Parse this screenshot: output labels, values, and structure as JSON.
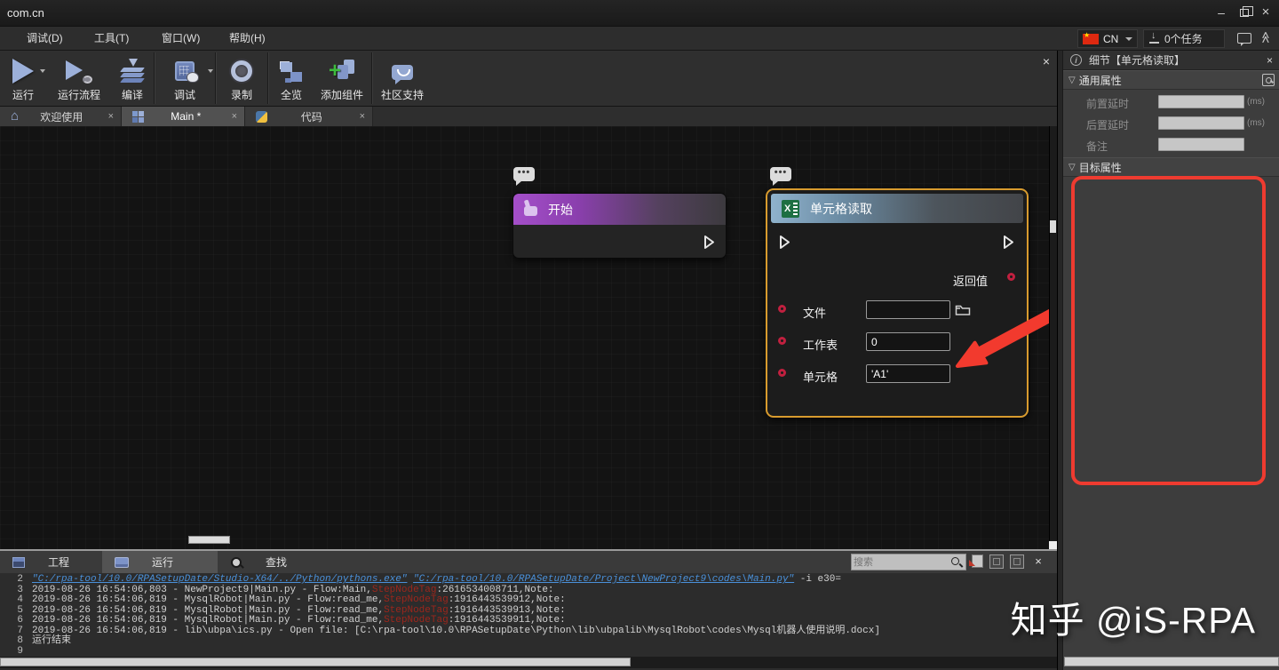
{
  "window": {
    "title": "com.cn"
  },
  "menu": {
    "items": [
      "调试(D)",
      "工具(T)",
      "窗口(W)",
      "帮助(H)"
    ],
    "lang": "CN",
    "tasks": "0个任务"
  },
  "toolbar": {
    "buttons": [
      {
        "label": "运行"
      },
      {
        "label": "运行流程"
      },
      {
        "label": "编译"
      },
      {
        "label": "调试"
      },
      {
        "label": "录制"
      },
      {
        "label": "全览"
      },
      {
        "label": "添加组件"
      },
      {
        "label": "社区支持"
      }
    ]
  },
  "tabs": [
    {
      "label": "欢迎使用"
    },
    {
      "label": "Main *"
    },
    {
      "label": "代码"
    }
  ],
  "canvas": {
    "start_node": {
      "title": "开始"
    },
    "cell_node": {
      "title": "单元格读取",
      "return_label": "返回值",
      "fields": [
        {
          "label": "文件",
          "value": ""
        },
        {
          "label": "工作表",
          "value": "0"
        },
        {
          "label": "单元格",
          "value": "'A1'"
        }
      ]
    }
  },
  "bottom_panel": {
    "tabs": [
      {
        "label": "工程"
      },
      {
        "label": "运行"
      },
      {
        "label": "查找"
      }
    ],
    "search_placeholder": "搜索",
    "log_lines": [
      {
        "num": "2",
        "segments": [
          {
            "type": "link",
            "text": "\"C:/rpa-tool/10.0/RPASetupDate/Studio-X64/../Python/pythons.exe\""
          },
          {
            "type": "plain",
            "text": "  "
          },
          {
            "type": "link",
            "text": "\"C:/rpa-tool/10.0/RPASetupDate/Project\\NewProject9\\codes\\Main.py\""
          },
          {
            "type": "plain",
            "text": " -i e30="
          }
        ]
      },
      {
        "num": "3",
        "segments": [
          {
            "type": "plain",
            "text": "2019-08-26 16:54:06,803 - NewProject9|Main.py - Flow:Main,"
          },
          {
            "type": "red",
            "text": "StepNodeTag"
          },
          {
            "type": "plain",
            "text": ":2616534008711,Note:"
          }
        ]
      },
      {
        "num": "4",
        "segments": [
          {
            "type": "plain",
            "text": "2019-08-26 16:54:06,819 - MysqlRobot|Main.py - Flow:read_me,"
          },
          {
            "type": "red",
            "text": "StepNodeTag"
          },
          {
            "type": "plain",
            "text": ":1916443539912,Note:"
          }
        ]
      },
      {
        "num": "5",
        "segments": [
          {
            "type": "plain",
            "text": "2019-08-26 16:54:06,819 - MysqlRobot|Main.py - Flow:read_me,"
          },
          {
            "type": "red",
            "text": "StepNodeTag"
          },
          {
            "type": "plain",
            "text": ":1916443539913,Note:"
          }
        ]
      },
      {
        "num": "6",
        "segments": [
          {
            "type": "plain",
            "text": "2019-08-26 16:54:06,819 - MysqlRobot|Main.py - Flow:read_me,"
          },
          {
            "type": "red",
            "text": "StepNodeTag"
          },
          {
            "type": "plain",
            "text": ":1916443539911,Note:"
          }
        ]
      },
      {
        "num": "7",
        "segments": [
          {
            "type": "plain",
            "text": "2019-08-26 16:54:06,819 - lib\\ubpa\\ics.py - Open file: [C:\\rpa-tool\\10.0\\RPASetupDate\\Python\\lib\\ubpalib\\MysqlRobot\\codes\\Mysql机器人使用说明.docx]"
          }
        ]
      },
      {
        "num": "8",
        "segments": [
          {
            "type": "plain",
            "text": "运行结束"
          }
        ]
      },
      {
        "num": "9",
        "segments": []
      }
    ]
  },
  "right_panel": {
    "title": "细节【单元格读取】",
    "general_section": "通用属性",
    "target_section": "目标属性",
    "rows": [
      {
        "label": "前置延时",
        "suffix": "(ms)"
      },
      {
        "label": "后置延时",
        "suffix": "(ms)"
      },
      {
        "label": "备注",
        "suffix": ""
      }
    ]
  },
  "glyphs": {
    "close": "×",
    "minimize": "–",
    "star": "★",
    "home": "⌂",
    "section_toggle": "▽",
    "collapse": "≫",
    "comment_dots": "•••",
    "info": "i"
  },
  "watermark": "知乎 @iS-RPA"
}
